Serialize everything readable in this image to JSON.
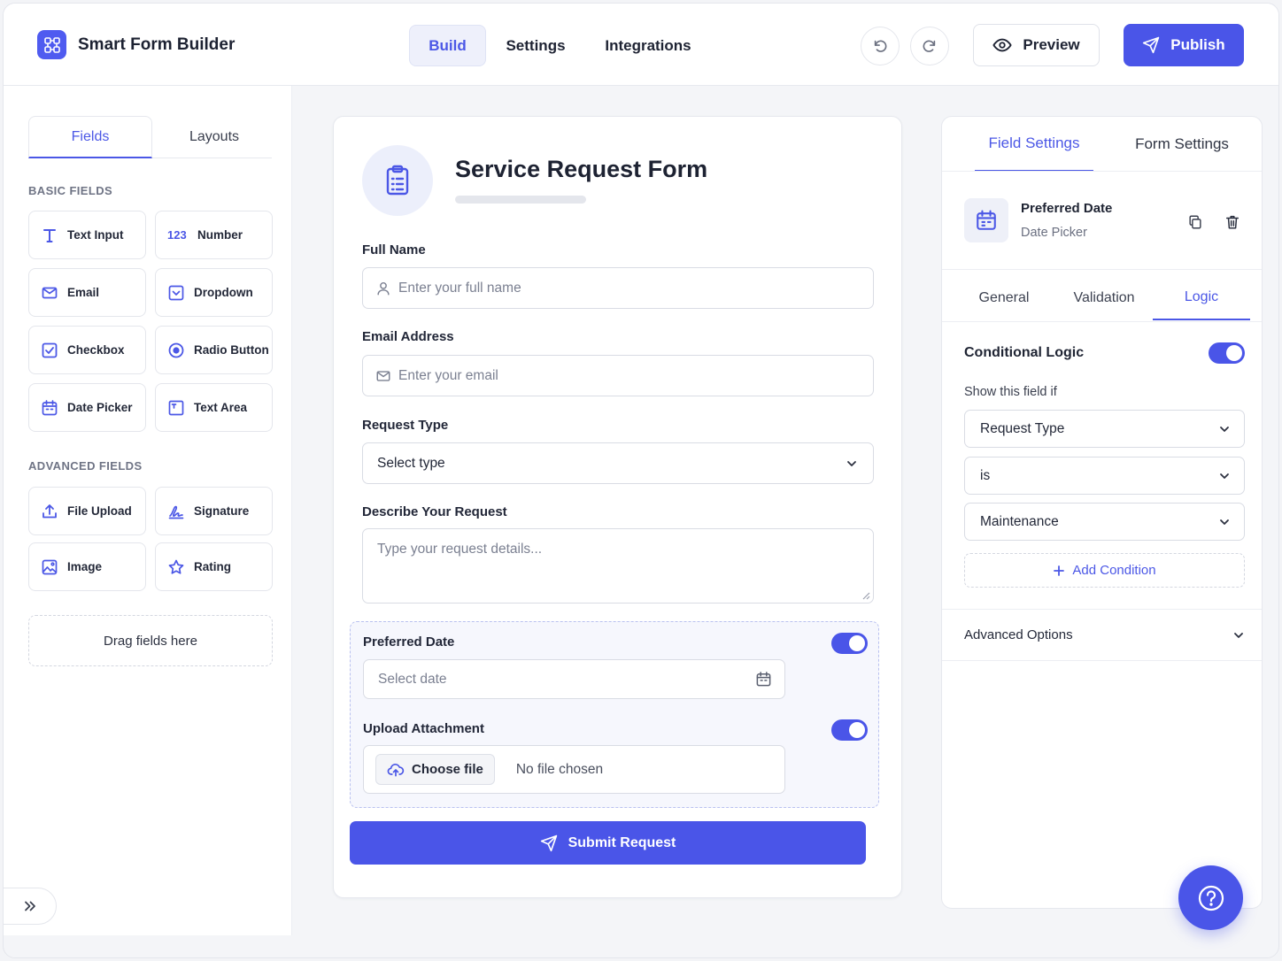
{
  "app": {
    "title": "Smart Form Builder"
  },
  "nav": {
    "tabs": [
      {
        "label": "Build"
      },
      {
        "label": "Settings"
      },
      {
        "label": "Integrations"
      }
    ]
  },
  "actions": {
    "preview": "Preview",
    "publish": "Publish"
  },
  "left": {
    "tabs": [
      {
        "label": "Fields"
      },
      {
        "label": "Layouts"
      }
    ],
    "basic_title": "BASIC FIELDS",
    "basic": [
      {
        "label": "Text Input",
        "icon": "text-icon"
      },
      {
        "label": "Number",
        "icon": "number-icon",
        "badge": "123"
      },
      {
        "label": "Email",
        "icon": "mail-icon"
      },
      {
        "label": "Dropdown",
        "icon": "dropdown-icon"
      },
      {
        "label": "Checkbox",
        "icon": "checkbox-icon"
      },
      {
        "label": "Radio Button",
        "icon": "radio-icon"
      },
      {
        "label": "Date Picker",
        "icon": "calendar-icon"
      },
      {
        "label": "Text Area",
        "icon": "textarea-icon"
      }
    ],
    "advanced_title": "ADVANCED FIELDS",
    "advanced": [
      {
        "label": "File Upload",
        "icon": "upload-icon"
      },
      {
        "label": "Signature",
        "icon": "signature-icon"
      },
      {
        "label": "Image",
        "icon": "image-icon"
      },
      {
        "label": "Rating",
        "icon": "star-icon"
      }
    ],
    "drag_zone": "Drag fields here"
  },
  "form": {
    "title": "Service Request Form",
    "full_name": {
      "label": "Full Name",
      "placeholder": "Enter your full name"
    },
    "email": {
      "label": "Email Address",
      "placeholder": "Enter your email"
    },
    "request_type": {
      "label": "Request Type",
      "value": "Select type"
    },
    "describe": {
      "label": "Describe Your Request",
      "placeholder": "Type your request details..."
    },
    "preferred_date": {
      "label": "Preferred Date",
      "placeholder": "Select date",
      "enabled": true
    },
    "upload": {
      "label": "Upload Attachment",
      "button": "Choose file",
      "status": "No file chosen",
      "enabled": true
    },
    "submit": "Submit Request"
  },
  "right": {
    "tabs": [
      {
        "label": "Field Settings"
      },
      {
        "label": "Form Settings"
      }
    ],
    "selected_field": {
      "name": "Preferred Date",
      "type": "Date Picker"
    },
    "subtabs": [
      {
        "label": "General"
      },
      {
        "label": "Validation"
      },
      {
        "label": "Logic"
      }
    ],
    "logic": {
      "title": "Conditional Logic",
      "enabled": true,
      "subtitle": "Show this field if",
      "field": "Request Type",
      "operator": "is",
      "value": "Maintenance",
      "add_condition": "Add Condition"
    },
    "advanced_options": "Advanced Options"
  },
  "colors": {
    "accent": "#4a55e8",
    "accent_soft": "#eef0fb",
    "border": "#d9dce4"
  }
}
